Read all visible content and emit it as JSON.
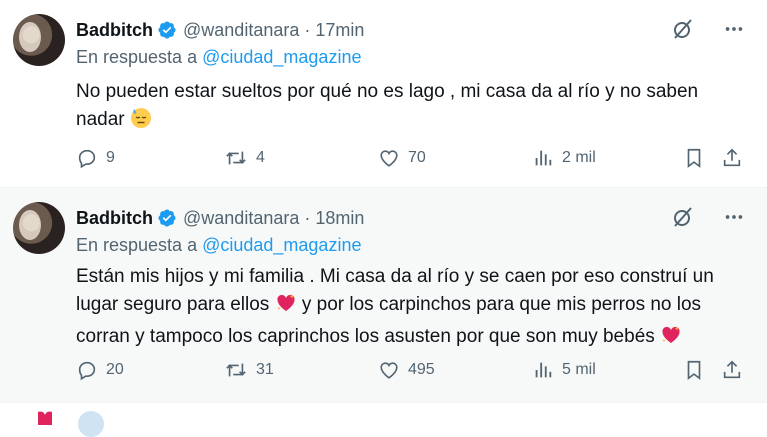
{
  "tweets": [
    {
      "author_name": "Badbitch",
      "handle": "@wanditanara",
      "separator": "·",
      "time": "17min",
      "reply_prefix": "En respuesta a ",
      "reply_to": "@ciudad_magazine",
      "text": "No pueden estar sueltos por qué no es lago , mi casa da al río y no saben nadar",
      "text_emoji": "downcast-sweat-face-emoji",
      "replies": "9",
      "retweets": "4",
      "likes": "70",
      "views": "2 mil"
    },
    {
      "author_name": "Badbitch",
      "handle": "@wanditanara",
      "separator": "·",
      "time": "18min",
      "reply_prefix": "En respuesta a ",
      "reply_to": "@ciudad_magazine",
      "text_part1": "Están mis hijos y mi familia . Mi casa da al río y se caen por eso construí un lugar seguro para ellos",
      "text_part2": "y por los carpinchos para que mis perros no los corran y tampoco los caprinchos los asusten por que son muy bebés",
      "text_emoji": "heart-with-sparkles-emoji",
      "replies": "20",
      "retweets": "31",
      "likes": "495",
      "views": "5 mil"
    }
  ],
  "colors": {
    "text": "#0f1419",
    "secondary": "#536471",
    "accent": "#1d9bf0",
    "highlight_bg": "#f7f9f9",
    "heart_emoji": "#e0245e"
  },
  "icons": [
    "verified-badge-icon",
    "grok-icon",
    "more-icon",
    "reply-icon",
    "retweet-icon",
    "like-icon",
    "views-icon",
    "bookmark-icon",
    "share-icon"
  ]
}
